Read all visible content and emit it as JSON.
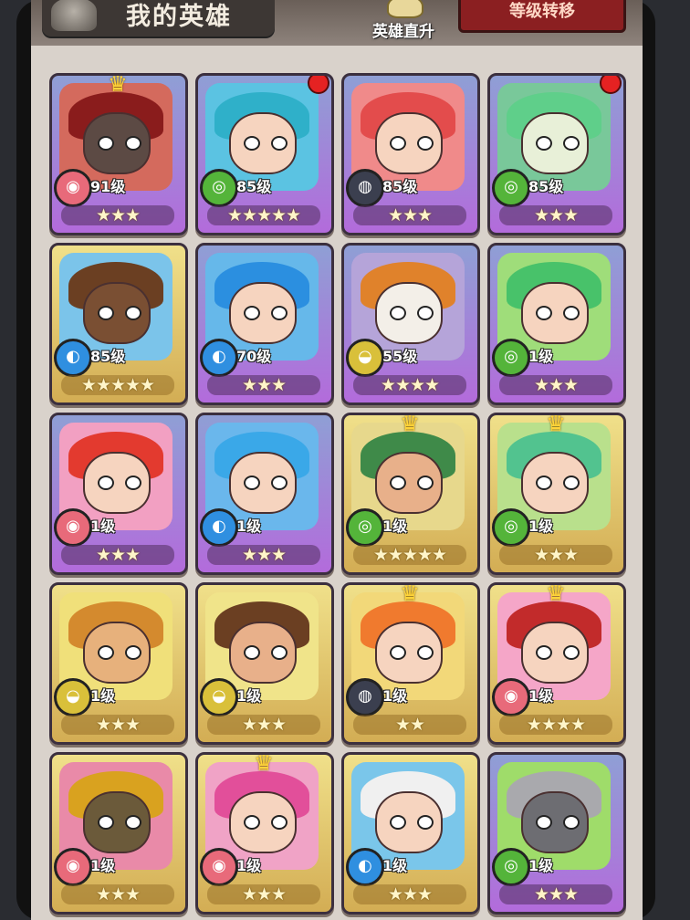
{
  "header": {
    "title": "我的英雄",
    "upgrade_label": "英雄直升",
    "level_reset_label": "等级转移"
  },
  "heroes": [
    {
      "level": "91级",
      "stars": "★★★",
      "faction": "fire",
      "frame": "purple",
      "crown": true,
      "notif": false,
      "hair": "#8a1c1c",
      "skin": "#5c4a44",
      "bg": "#d46a5d"
    },
    {
      "level": "85级",
      "stars": "★★★★★",
      "faction": "nature",
      "frame": "purple",
      "crown": false,
      "notif": true,
      "hair": "#2fb0c9",
      "skin": "#f6d4bf",
      "bg": "#5bc3e2"
    },
    {
      "level": "85级",
      "stars": "★★★",
      "faction": "dark",
      "frame": "purple",
      "crown": false,
      "notif": false,
      "hair": "#e34c4c",
      "skin": "#f6d4bf",
      "bg": "#f08a8a"
    },
    {
      "level": "85级",
      "stars": "★★★",
      "faction": "nature",
      "frame": "purple",
      "crown": false,
      "notif": true,
      "hair": "#5fcf8a",
      "skin": "#e8f0d8",
      "bg": "#79c89a"
    },
    {
      "level": "85级",
      "stars": "★★★★★",
      "faction": "water",
      "frame": "gold",
      "crown": false,
      "notif": false,
      "hair": "#6b3f22",
      "skin": "#7a4f33",
      "bg": "#7bc4ea"
    },
    {
      "level": "70级",
      "stars": "★★★",
      "faction": "water",
      "frame": "purple",
      "crown": false,
      "notif": false,
      "hair": "#2b8fe0",
      "skin": "#f6d4bf",
      "bg": "#66b8ea"
    },
    {
      "level": "55级",
      "stars": "★★★★",
      "faction": "light",
      "frame": "purple",
      "crown": false,
      "notif": false,
      "hair": "#e0822b",
      "skin": "#f3efe8",
      "bg": "#b5a4d9"
    },
    {
      "level": "1级",
      "stars": "★★★",
      "faction": "nature",
      "frame": "purple",
      "crown": false,
      "notif": false,
      "hair": "#48c26a",
      "skin": "#f6d4bf",
      "bg": "#9fdd7a"
    },
    {
      "level": "1级",
      "stars": "★★★",
      "faction": "fire",
      "frame": "purple",
      "crown": false,
      "notif": false,
      "hair": "#e33a2f",
      "skin": "#f6d4bf",
      "bg": "#f2a0c2"
    },
    {
      "level": "1级",
      "stars": "★★★",
      "faction": "water",
      "frame": "purple",
      "crown": false,
      "notif": false,
      "hair": "#3aa8e8",
      "skin": "#f6d4bf",
      "bg": "#6ab7ec"
    },
    {
      "level": "1级",
      "stars": "★★★★★",
      "faction": "nature",
      "frame": "gold",
      "crown": true,
      "notif": false,
      "hair": "#3f8a49",
      "skin": "#e8b08a",
      "bg": "#e7d88c"
    },
    {
      "level": "1级",
      "stars": "★★★",
      "faction": "nature",
      "frame": "gold",
      "crown": true,
      "notif": false,
      "hair": "#52c38f",
      "skin": "#f6d4bf",
      "bg": "#b9e08c"
    },
    {
      "level": "1级",
      "stars": "★★★",
      "faction": "light",
      "frame": "gold",
      "crown": false,
      "notif": false,
      "hair": "#d48a2e",
      "skin": "#e7b17c",
      "bg": "#f0e07a"
    },
    {
      "level": "1级",
      "stars": "★★★",
      "faction": "light",
      "frame": "gold",
      "crown": false,
      "notif": false,
      "hair": "#6b3f22",
      "skin": "#e8b08a",
      "bg": "#f0e48a"
    },
    {
      "level": "1级",
      "stars": "★★",
      "faction": "dark",
      "frame": "gold",
      "crown": true,
      "notif": false,
      "hair": "#f07a2e",
      "skin": "#f6d4bf",
      "bg": "#f2d879"
    },
    {
      "level": "1级",
      "stars": "★★★★",
      "faction": "fire",
      "frame": "gold",
      "crown": true,
      "notif": false,
      "hair": "#c22b2b",
      "skin": "#f6d4bf",
      "bg": "#f5a6c8"
    },
    {
      "level": "1级",
      "stars": "★★★",
      "faction": "fire",
      "frame": "gold",
      "crown": false,
      "notif": false,
      "hair": "#d9a21f",
      "skin": "#6b5a3a",
      "bg": "#e98aa8"
    },
    {
      "level": "1级",
      "stars": "★★★",
      "faction": "fire",
      "frame": "gold",
      "crown": true,
      "notif": false,
      "hair": "#e24f9a",
      "skin": "#f6d4bf",
      "bg": "#f0a3c6"
    },
    {
      "level": "1级",
      "stars": "★★★",
      "faction": "water",
      "frame": "gold",
      "crown": false,
      "notif": false,
      "hair": "#f0f0f0",
      "skin": "#f6d4bf",
      "bg": "#7ac6ea"
    },
    {
      "level": "1级",
      "stars": "★★★",
      "faction": "nature",
      "frame": "purple",
      "crown": false,
      "notif": false,
      "hair": "#a9a9ad",
      "skin": "#6d6d72",
      "bg": "#9fdc6a"
    }
  ],
  "faction_colors": {
    "fire": "#e86a7a",
    "nature": "#54b43a",
    "water": "#2f8fe0",
    "dark": "#3b3f4f",
    "light": "#d9c03a"
  },
  "faction_glyph": {
    "fire": "◉",
    "nature": "◎",
    "water": "◐",
    "dark": "◍",
    "light": "◒"
  }
}
